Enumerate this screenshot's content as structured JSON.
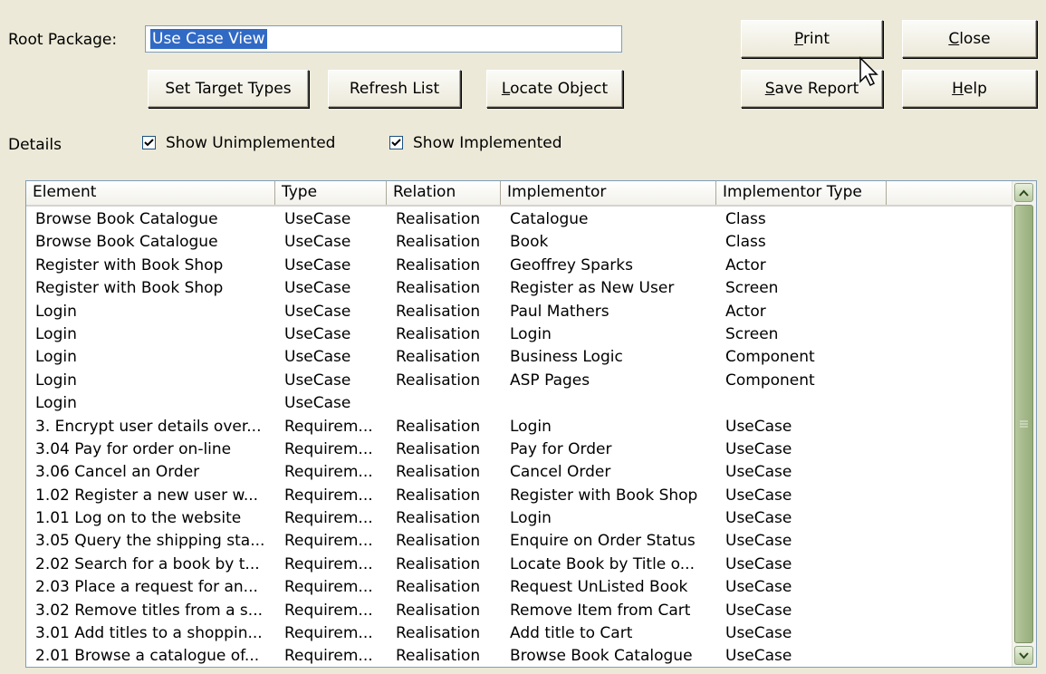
{
  "root_package": {
    "label": "Root Package:",
    "value": "Use Case View"
  },
  "buttons": {
    "set_target_types": "Set Target Types",
    "refresh_list": "Refresh List",
    "locate_object": {
      "accel": "L",
      "rest": "ocate Object"
    },
    "print": {
      "accel": "P",
      "rest": "rint"
    },
    "close": {
      "accel": "C",
      "rest": "lose"
    },
    "save_report": {
      "accel": "S",
      "rest": "ave Report"
    },
    "help": {
      "accel": "H",
      "rest": "elp"
    }
  },
  "details_label": "Details",
  "checkboxes": {
    "show_unimplemented": {
      "label": "Show Unimplemented",
      "checked": true
    },
    "show_implemented": {
      "label": "Show Implemented",
      "checked": true
    }
  },
  "table": {
    "headers": [
      "Element",
      "Type",
      "Relation",
      "Implementor",
      "Implementor Type"
    ],
    "rows": [
      [
        "Browse Book Catalogue",
        "UseCase",
        "Realisation",
        "Catalogue",
        "Class"
      ],
      [
        "Browse Book Catalogue",
        "UseCase",
        "Realisation",
        "Book",
        "Class"
      ],
      [
        "Register with Book Shop",
        "UseCase",
        "Realisation",
        "Geoffrey Sparks",
        "Actor"
      ],
      [
        "Register with Book Shop",
        "UseCase",
        "Realisation",
        "Register as New User",
        "Screen"
      ],
      [
        "Login",
        "UseCase",
        "Realisation",
        "Paul Mathers",
        "Actor"
      ],
      [
        "Login",
        "UseCase",
        "Realisation",
        "Login",
        "Screen"
      ],
      [
        "Login",
        "UseCase",
        "Realisation",
        "Business Logic",
        "Component"
      ],
      [
        "Login",
        "UseCase",
        "Realisation",
        "ASP Pages",
        "Component"
      ],
      [
        "Login",
        "UseCase",
        "",
        "",
        ""
      ],
      [
        "3. Encrypt user details over...",
        "Requirem...",
        "Realisation",
        "Login",
        "UseCase"
      ],
      [
        "3.04 Pay for order on-line",
        "Requirem...",
        "Realisation",
        "Pay for Order",
        "UseCase"
      ],
      [
        "3.06 Cancel an Order",
        "Requirem...",
        "Realisation",
        "Cancel Order",
        "UseCase"
      ],
      [
        "1.02 Register a new user w...",
        "Requirem...",
        "Realisation",
        "Register with Book Shop",
        "UseCase"
      ],
      [
        "1.01 Log on to the website",
        "Requirem...",
        "Realisation",
        "Login",
        "UseCase"
      ],
      [
        "3.05 Query the shipping sta...",
        "Requirem...",
        "Realisation",
        "Enquire on Order Status",
        "UseCase"
      ],
      [
        "2.02 Search for a book by t...",
        "Requirem...",
        "Realisation",
        "Locate Book by Title o...",
        "UseCase"
      ],
      [
        "2.03 Place a request for an...",
        "Requirem...",
        "Realisation",
        "Request UnListed Book",
        "UseCase"
      ],
      [
        "3.02 Remove titles from a s...",
        "Requirem...",
        "Realisation",
        "Remove Item from Cart",
        "UseCase"
      ],
      [
        "3.01 Add titles to a shoppin...",
        "Requirem...",
        "Realisation",
        "Add title to Cart",
        "UseCase"
      ],
      [
        "2.01 Browse a catalogue of...",
        "Requirem...",
        "Realisation",
        "Browse Book Catalogue",
        "UseCase"
      ]
    ]
  },
  "icons": {
    "scroll_up": "scroll-up-arrow-icon",
    "scroll_down": "scroll-down-arrow-icon",
    "checkmark": "checkmark-icon",
    "cursor": "mouse-pointer-icon"
  }
}
